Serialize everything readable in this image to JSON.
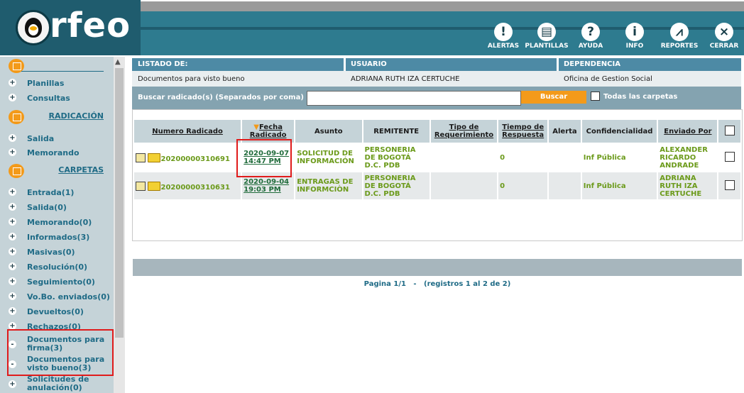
{
  "brand": {
    "logo_text": "rfeo"
  },
  "toolbar": [
    {
      "label": "ALERTAS",
      "icon": "alert-icon"
    },
    {
      "label": "PLANTILLAS",
      "icon": "template-icon"
    },
    {
      "label": "AYUDA",
      "icon": "help-icon"
    },
    {
      "label": "INFO",
      "icon": "info-icon"
    },
    {
      "label": "REPORTES",
      "icon": "reports-icon"
    },
    {
      "label": "CERRAR",
      "icon": "close-icon"
    }
  ],
  "sidebar": {
    "top_items": [
      {
        "label": "Planillas"
      },
      {
        "label": "Consultas"
      }
    ],
    "radicacion_title": "RADICACIÓN",
    "radicacion_items": [
      {
        "label": "Salida"
      },
      {
        "label": "Memorando"
      }
    ],
    "carpetas_title": "CARPETAS",
    "folders": [
      {
        "label": "Entrada(1)"
      },
      {
        "label": "Salida(0)"
      },
      {
        "label": "Memorando(0)"
      },
      {
        "label": "Informados(3)"
      },
      {
        "label": "Masivas(0)"
      },
      {
        "label": "Resolución(0)"
      },
      {
        "label": "Seguimiento(0)"
      },
      {
        "label": "Vo.Bo. enviados(0)"
      },
      {
        "label": "Devueltos(0)"
      },
      {
        "label": "Rechazos(0)"
      },
      {
        "label": "Documentos para firma(3)"
      },
      {
        "label": "Documentos para visto bueno(3)"
      },
      {
        "label": "Solicitudes de anulación(0)"
      }
    ]
  },
  "listing": {
    "h_listado": "LISTADO DE:",
    "h_usuario": "USUARIO",
    "h_dependencia": "DEPENDENCIA",
    "v_listado": "Documentos para visto bueno",
    "v_usuario": "ADRIANA RUTH IZA CERTUCHE",
    "v_dependencia": "Oficina de Gestion Social"
  },
  "search": {
    "label": "Buscar radicado(s) (Separados por coma)",
    "value": "",
    "button": "Buscar",
    "all_folders": "Todas las carpetas"
  },
  "table": {
    "headers": {
      "numero": "Numero Radicado",
      "fecha": "Fecha Radicado",
      "asunto": "Asunto",
      "remitente": "REMITENTE",
      "tipo": "Tipo de Requerimiento",
      "tiempo": "Tiempo de Respuesta",
      "alerta": "Alerta",
      "conf": "Confidencialidad",
      "enviado": "Enviado Por"
    },
    "rows": [
      {
        "numero": "20200000310691",
        "fecha": "2020-09-07 14:47 PM",
        "asunto": "SOLICITUD DE INFORMACIÓN",
        "remitente": "PERSONERIA DE BOGOTÁ D.C. PDB",
        "tipo": "",
        "tiempo": "0",
        "alerta": "",
        "conf": "Inf Pública",
        "enviado": "ALEXANDER RICARDO ANDRADE"
      },
      {
        "numero": "20200000310631",
        "fecha": "2020-09-04 19:03 PM",
        "asunto": "ENTRAGAS DE INFORMCIÒN",
        "remitente": "PERSONERIA DE BOGOTÁ D.C. PDB",
        "tipo": "",
        "tiempo": "0",
        "alerta": "",
        "conf": "Inf Pública",
        "enviado": "ADRIANA RUTH IZA CERTUCHE"
      }
    ]
  },
  "pager": {
    "text": "Pagina 1/1   -   (registros 1 al 2 de 2)"
  },
  "colors": {
    "accent": "#f39a1a",
    "header": "#2e7b8f",
    "sidebar": "#c5d3d8",
    "link_green": "#6b9a1a"
  }
}
